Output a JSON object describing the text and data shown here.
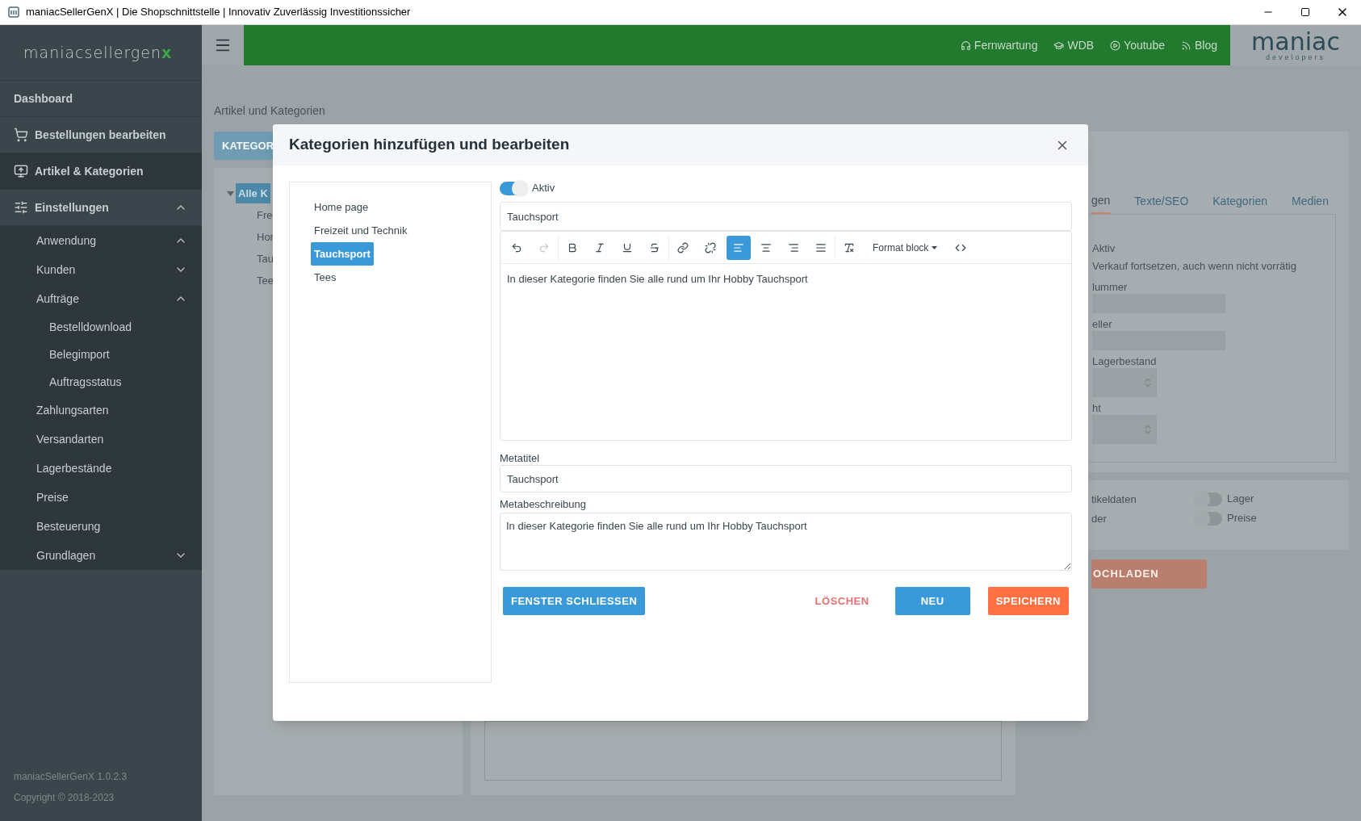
{
  "window": {
    "title": "maniacSellerGenX | Die Shopschnittstelle | Innovativ Zuverlässig Investitionssicher"
  },
  "sidebar": {
    "logo": {
      "text": "maniacsellergen",
      "accent": "x"
    },
    "items": [
      {
        "label": "Dashboard",
        "selected": false
      },
      {
        "label": "Bestellungen bearbeiten",
        "selected": false
      },
      {
        "label": "Artikel & Kategorien",
        "selected": true
      },
      {
        "label": "Einstellungen",
        "selected": false,
        "expanded": true,
        "children": [
          {
            "label": "Anwendung",
            "expanded": true
          },
          {
            "label": "Kunden",
            "expanded": false
          },
          {
            "label": "Aufträge",
            "expanded": true,
            "children": [
              {
                "label": "Bestelldownload"
              },
              {
                "label": "Belegimport"
              },
              {
                "label": "Auftragsstatus"
              }
            ]
          },
          {
            "label": "Zahlungsarten"
          },
          {
            "label": "Versandarten"
          },
          {
            "label": "Lagerbestände"
          },
          {
            "label": "Preise"
          },
          {
            "label": "Besteuerung"
          },
          {
            "label": "Grundlagen",
            "expanded": false
          }
        ]
      }
    ],
    "version": "maniacSellerGenX 1.0.2.3",
    "copyright": "Copyright © 2018-2023"
  },
  "topbar": {
    "links": [
      {
        "label": "Fernwartung"
      },
      {
        "label": "WDB"
      },
      {
        "label": "Youtube"
      },
      {
        "label": "Blog"
      }
    ],
    "logo": {
      "text": "maniac",
      "subtitle": "developers"
    }
  },
  "page": {
    "breadcrumb": "Artikel und Kategorien",
    "left": {
      "button": "KATEGOR",
      "tree": [
        {
          "label": "Alle K",
          "selected": true,
          "expanded": true,
          "children": [
            {
              "label": "Fre",
              "selected": false
            },
            {
              "label": "Hor",
              "selected": false
            },
            {
              "label": "Tau",
              "selected": false
            },
            {
              "label": "Tee",
              "selected": false
            }
          ]
        }
      ]
    },
    "right": {
      "tabs": [
        {
          "label": "gen",
          "selected": true
        },
        {
          "label": "Texte/SEO",
          "selected": false
        },
        {
          "label": "Kategorien",
          "selected": false
        },
        {
          "label": "Medien",
          "selected": false
        }
      ],
      "options": [
        "Aktiv",
        "Verkauf fortsetzen, auch wenn nicht vorrätig"
      ],
      "fields": [
        {
          "label": "lummer",
          "kind": "text"
        },
        {
          "label": "eller",
          "kind": "text"
        },
        {
          "label": "Lagerbestand",
          "kind": "number"
        },
        {
          "label": "ht",
          "kind": "number"
        }
      ],
      "sync_left": [
        "tikeldaten",
        "der"
      ],
      "sync_toggles": [
        {
          "label": "Lager",
          "on": false
        },
        {
          "label": "Preise",
          "on": false
        }
      ],
      "button": "OCHLADEN"
    }
  },
  "modal": {
    "title": "Kategorien hinzufügen und bearbeiten",
    "categories": [
      {
        "label": "Home page",
        "selected": false
      },
      {
        "label": "Freizeit und Technik",
        "selected": false
      },
      {
        "label": "Tauchsport",
        "selected": true
      },
      {
        "label": "Tees",
        "selected": false
      }
    ],
    "active": {
      "label": "Aktiv",
      "on": true
    },
    "name": {
      "value": "Tauchsport"
    },
    "toolbar": [
      {
        "items": [
          {
            "kind": "button",
            "selected": false,
            "disabled": false
          },
          {
            "kind": "button",
            "selected": false,
            "disabled": true
          }
        ]
      },
      {
        "items": [
          {
            "kind": "button",
            "selected": false,
            "disabled": false
          },
          {
            "kind": "button",
            "selected": false,
            "disabled": false
          },
          {
            "kind": "button",
            "selected": false,
            "disabled": false
          },
          {
            "kind": "button",
            "selected": false,
            "disabled": false
          }
        ]
      },
      {
        "items": [
          {
            "kind": "button",
            "selected": false,
            "disabled": false
          },
          {
            "kind": "button",
            "selected": false,
            "disabled": false
          }
        ]
      },
      {
        "items": [
          {
            "kind": "button",
            "selected": true,
            "disabled": false
          },
          {
            "kind": "button",
            "selected": false,
            "disabled": false
          },
          {
            "kind": "button",
            "selected": false,
            "disabled": false
          },
          {
            "kind": "button",
            "selected": false,
            "disabled": false
          }
        ]
      },
      {
        "items": [
          {
            "kind": "button",
            "selected": false,
            "disabled": false
          },
          {
            "kind": "dropdown",
            "label": "Format block"
          },
          {
            "kind": "button",
            "selected": false,
            "disabled": false
          }
        ]
      }
    ],
    "editor": {
      "value": "In dieser Kategorie finden Sie alle rund um Ihr Hobby Tauchsport"
    },
    "meta_title": {
      "label": "Metatitel",
      "value": "Tauchsport"
    },
    "meta_description": {
      "label": "Metabeschreibung",
      "value": "In dieser Kategorie finden Sie alle rund um Ihr Hobby Tauchsport"
    },
    "buttons": [
      {
        "label": "FENSTER SCHLIESSEN",
        "kind": "primary"
      },
      {
        "label": "LÖSCHEN",
        "kind": "danger"
      },
      {
        "label": "NEU",
        "kind": "primary"
      },
      {
        "label": "SPEICHERN",
        "kind": "warning"
      }
    ]
  }
}
